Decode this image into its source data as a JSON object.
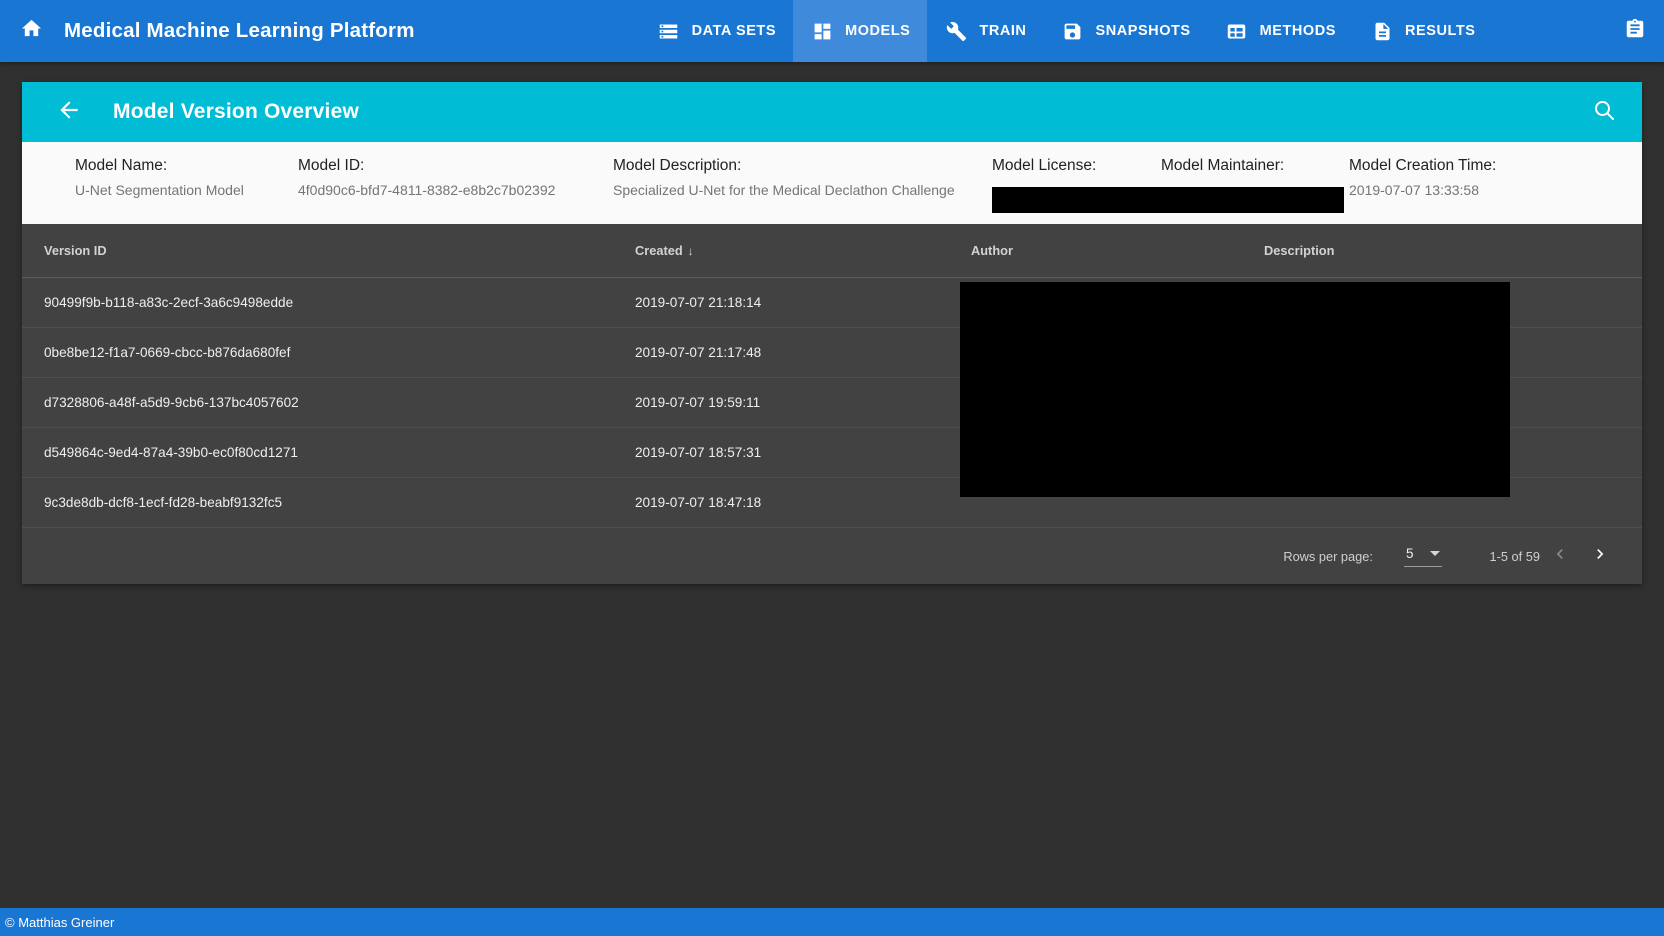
{
  "topbar": {
    "home_icon": "home-icon",
    "app_title": "Medical Machine Learning Platform",
    "nav": [
      {
        "label": "DATA SETS",
        "icon": "storage-icon",
        "active": false
      },
      {
        "label": "MODELS",
        "icon": "dashboard-icon",
        "active": true
      },
      {
        "label": "TRAIN",
        "icon": "wrench-icon",
        "active": false
      },
      {
        "label": "SNAPSHOTS",
        "icon": "save-icon",
        "active": false
      },
      {
        "label": "METHODS",
        "icon": "table-chart-icon",
        "active": false
      },
      {
        "label": "RESULTS",
        "icon": "description-icon",
        "active": false
      }
    ],
    "clipboard_icon": "clipboard-icon"
  },
  "card": {
    "back_icon": "arrow-back-icon",
    "title": "Model Version Overview",
    "search_icon": "search-icon"
  },
  "meta": {
    "name_label": "Model Name:",
    "name_value": "U-Net Segmentation Model",
    "id_label": "Model ID:",
    "id_value": "4f0d90c6-bfd7-4811-8382-e8b2c7b02392",
    "description_label": "Model Description:",
    "description_value": "Specialized U-Net for the Medical Declathon Challenge",
    "license_label": "Model License:",
    "license_value": "",
    "maintainer_label": "Model Maintainer:",
    "maintainer_value": "",
    "creation_label": "Model Creation Time:",
    "creation_value": "2019-07-07 13:33:58"
  },
  "table": {
    "columns": [
      {
        "key": "version_id",
        "label": "Version ID",
        "sorted": false
      },
      {
        "key": "created",
        "label": "Created",
        "sorted": true,
        "sort_dir": "desc",
        "sort_glyph": "↓"
      },
      {
        "key": "author",
        "label": "Author",
        "sorted": false
      },
      {
        "key": "description",
        "label": "Description",
        "sorted": false
      }
    ],
    "rows": [
      {
        "version_id": "90499f9b-b118-a83c-2ecf-3a6c9498edde",
        "created": "2019-07-07 21:18:14",
        "author": "",
        "description": ""
      },
      {
        "version_id": "0be8be12-f1a7-0669-cbcc-b876da680fef",
        "created": "2019-07-07 21:17:48",
        "author": "",
        "description": ""
      },
      {
        "version_id": "d7328806-a48f-a5d9-9cb6-137bc4057602",
        "created": "2019-07-07 19:59:11",
        "author": "",
        "description": ""
      },
      {
        "version_id": "d549864c-9ed4-87a4-39b0-ec0f80cd1271",
        "created": "2019-07-07 18:57:31",
        "author": "",
        "description": ""
      },
      {
        "version_id": "9c3de8db-dcf8-1ecf-fd28-beabf9132fc5",
        "created": "2019-07-07 18:47:18",
        "author": "",
        "description": ""
      }
    ]
  },
  "paginator": {
    "rows_per_page_label": "Rows per page:",
    "rows_per_page_value": "5",
    "range_label": "1-5 of 59",
    "prev_icon": "chevron-left-icon",
    "next_icon": "chevron-right-icon",
    "prev_disabled": true
  },
  "footer": {
    "copyright": "© Matthias Greiner"
  },
  "colors": {
    "primary": "#1976d2",
    "accent": "#00bcd4",
    "active_nav": "#3f8ada",
    "card_bg": "#424242",
    "page_bg": "#303030",
    "meta_bg": "#fafafa",
    "redaction": "#000000"
  }
}
